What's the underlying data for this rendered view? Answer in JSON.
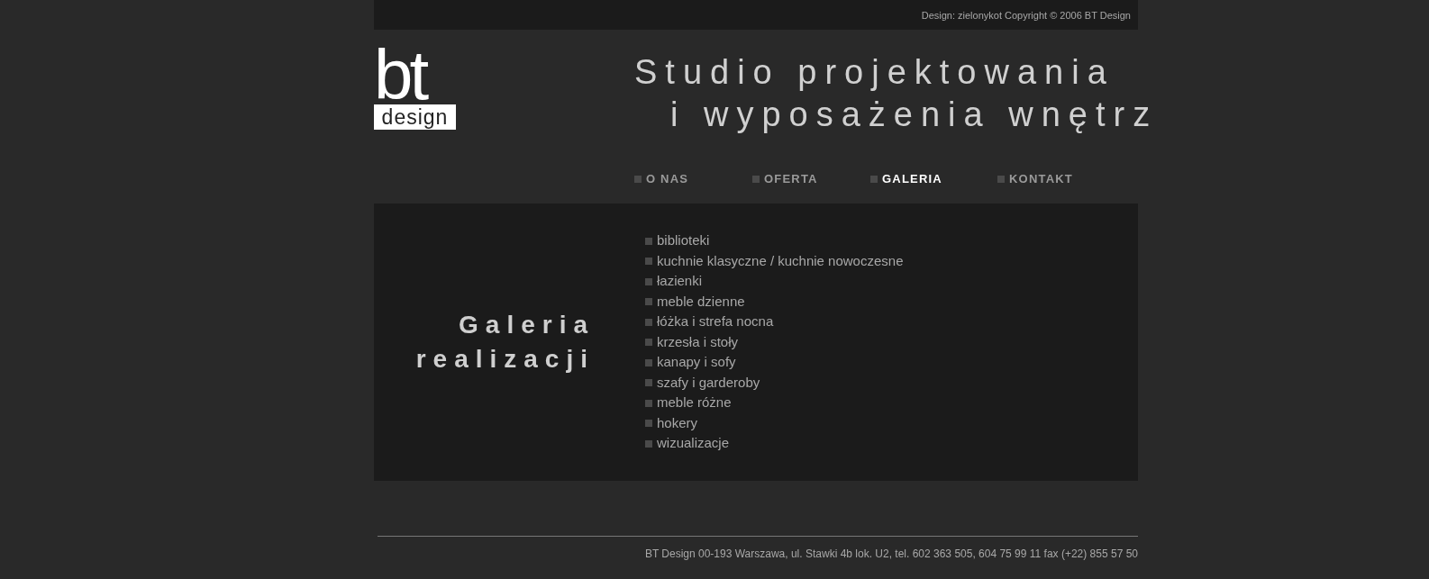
{
  "top_bar": {
    "credit": "Design: zielonykot Copyright © 2006 BT Design"
  },
  "logo": {
    "mark": "bt",
    "subtitle": "design"
  },
  "header": {
    "title_lines": [
      "Studio projektowania",
      "i wyposażenia wnętrz"
    ]
  },
  "nav": [
    {
      "label": "O NAS",
      "selected": false
    },
    {
      "label": "OFERTA",
      "selected": false
    },
    {
      "label": "GALERIA",
      "selected": true
    },
    {
      "label": "KONTAKT",
      "selected": false
    }
  ],
  "gallery": {
    "heading_lines": [
      "Galeria",
      "realizacji"
    ],
    "links": [
      "biblioteki",
      "kuchnie klasyczne / kuchnie nowoczesne",
      "łazienki",
      "meble dzienne",
      "łóżka i strefa nocna",
      "krzesła i stoły",
      "kanapy i sofy",
      "szafy i garderoby",
      "meble różne",
      "hokery",
      "wizualizacje"
    ]
  },
  "footer": {
    "address": "BT Design 00-193 Warszawa, ul. Stawki 4b lok. U2, tel. 602 363 505, 604 75 99 11 fax (+22) 855 57 50"
  }
}
